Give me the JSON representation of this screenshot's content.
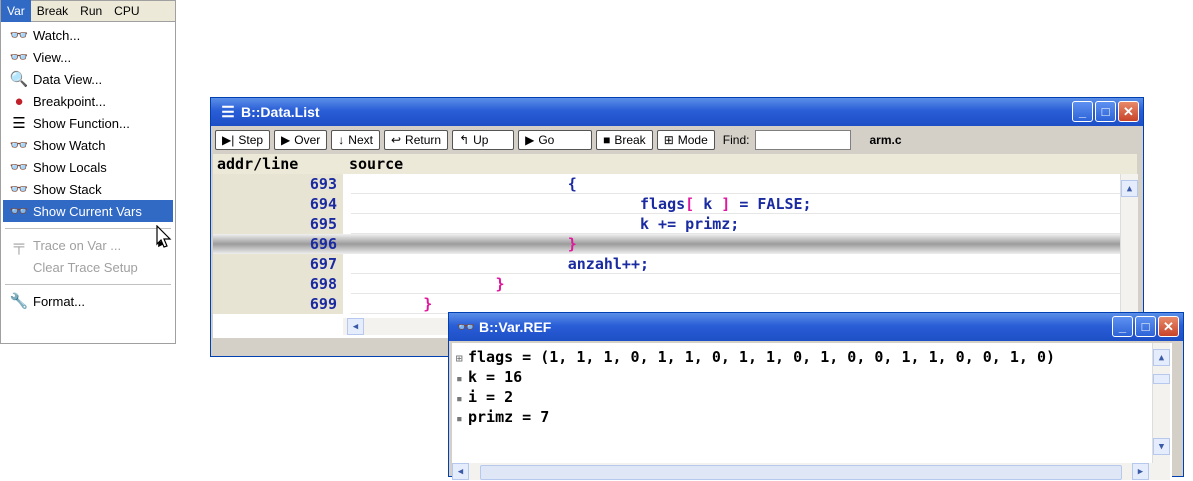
{
  "menubar": {
    "items": [
      "Var",
      "Break",
      "Run",
      "CPU"
    ]
  },
  "menu": {
    "items": [
      {
        "label": "Watch...",
        "icon": "glasses-icon"
      },
      {
        "label": "View...",
        "icon": "glasses-icon"
      },
      {
        "label": "Data View...",
        "icon": "magnifier-icon"
      },
      {
        "label": "Breakpoint...",
        "icon": "breakpoint-icon"
      },
      {
        "label": "Show Function...",
        "icon": "list-icon"
      },
      {
        "label": "Show Watch",
        "icon": "glasses-icon"
      },
      {
        "label": "Show Locals",
        "icon": "glasses-icon"
      },
      {
        "label": "Show Stack",
        "icon": "glasses-icon"
      },
      {
        "label": "Show Current Vars",
        "icon": "glasses-icon"
      },
      {
        "label": "Trace on Var ...",
        "icon": "trace-icon"
      },
      {
        "label": "Clear Trace Setup",
        "icon": ""
      },
      {
        "label": "Format...",
        "icon": "wrench-icon"
      }
    ]
  },
  "datalist": {
    "title": "B::Data.List",
    "toolbar": {
      "step": "Step",
      "over": "Over",
      "next": "Next",
      "return": "Return",
      "up": "Up",
      "go": "Go",
      "break": "Break",
      "mode": "Mode",
      "find": "Find:",
      "file": "arm.c"
    },
    "columns": [
      "addr/line",
      "source"
    ],
    "rows": [
      {
        "line": "693",
        "pre": "                        {",
        "hl": "",
        "post": ""
      },
      {
        "line": "694",
        "pre": "                                flags",
        "hl": "[",
        "post": " k ",
        "hl2": "]",
        "post2": " = FALSE;"
      },
      {
        "line": "695",
        "pre": "                                k += primz;",
        "hl": "",
        "post": ""
      },
      {
        "line": "696",
        "pre": "                        ",
        "hl": "}",
        "post": ""
      },
      {
        "line": "697",
        "pre": "                        anzahl++;",
        "hl": "",
        "post": ""
      },
      {
        "line": "698",
        "pre": "                ",
        "hl": "}",
        "post": ""
      },
      {
        "line": "699",
        "pre": "        ",
        "hl": "}",
        "post": ""
      }
    ]
  },
  "varref": {
    "title": "B::Var.REF",
    "lines": [
      {
        "mark": "⊞",
        "text": "flags = (1, 1, 1, 0, 1, 1, 0, 1, 1, 0, 1, 0, 0, 1, 1, 0, 0, 1, 0)"
      },
      {
        "mark": "▪",
        "text": "k = 16"
      },
      {
        "mark": "▪",
        "text": "i = 2"
      },
      {
        "mark": "▪",
        "text": "primz = 7"
      }
    ]
  },
  "colors": {
    "accent": "#316ac5",
    "title_blue": "#2a5ed6",
    "code_blue": "#1a2aa0",
    "bracket_pink": "#e0169c"
  }
}
